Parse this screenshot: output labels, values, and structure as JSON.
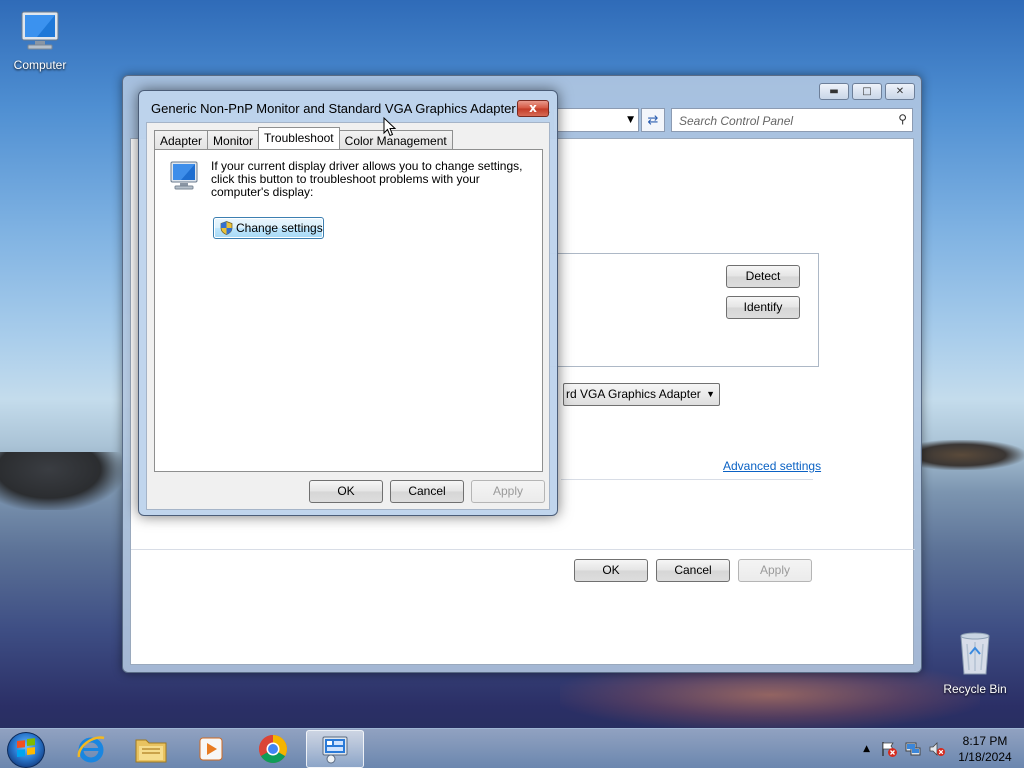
{
  "desktop": {
    "icons": [
      {
        "label": "Computer"
      },
      {
        "label": "Recycle Bin"
      }
    ]
  },
  "background_window": {
    "search_placeholder": "Search Control Panel",
    "detect_label": "Detect",
    "identify_label": "Identify",
    "display_value": "rd VGA Graphics Adapter",
    "advanced_link": "Advanced settings",
    "ok_label": "OK",
    "cancel_label": "Cancel",
    "apply_label": "Apply"
  },
  "dialog": {
    "title": "Generic Non-PnP Monitor and Standard VGA Graphics Adapter Pro...",
    "close_label": "x",
    "tabs": [
      {
        "label": "Adapter"
      },
      {
        "label": "Monitor"
      },
      {
        "label": "Troubleshoot"
      },
      {
        "label": "Color Management"
      }
    ],
    "active_tab": "Troubleshoot",
    "troubleshoot_text": "If your current display driver allows you to change settings, click this button to troubleshoot problems with your computer's display:",
    "change_settings_label": "Change settings",
    "ok_label": "OK",
    "cancel_label": "Cancel",
    "apply_label": "Apply"
  },
  "taskbar": {
    "apps": [
      "start-orb",
      "internet-explorer-icon",
      "windows-explorer-icon",
      "media-player-icon",
      "chrome-icon",
      "display-settings-icon"
    ],
    "clock_time": "8:17 PM",
    "clock_date": "1/18/2024"
  },
  "colors": {
    "accent_link": "#0b62c4",
    "close_button": "#c23a26"
  }
}
